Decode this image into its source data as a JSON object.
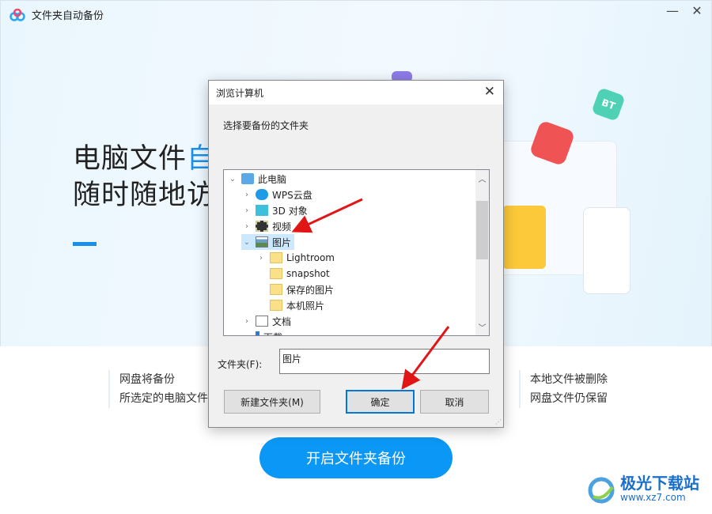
{
  "app": {
    "title": "文件夹自动备份",
    "minimize": "—",
    "close": "✕"
  },
  "hero": {
    "line1_a": "电脑文件",
    "line1_b": "自",
    "line2": "随时随地访"
  },
  "info_left": {
    "line1": "网盘将备份",
    "line2": "所选定的电脑文件"
  },
  "info_right": {
    "line1": "本地文件被删除",
    "line2": "网盘文件仍保留"
  },
  "start_button": "开启文件夹备份",
  "dialog": {
    "title": "浏览计算机",
    "close": "✕",
    "prompt": "选择要备份的文件夹",
    "tree": [
      {
        "label": "此电脑",
        "icon": "computer-icon",
        "expanded": true,
        "level": 0
      },
      {
        "label": "WPS云盘",
        "icon": "cloud-icon",
        "expanded": false,
        "level": 1
      },
      {
        "label": "3D 对象",
        "icon": "cube-icon",
        "expanded": false,
        "level": 1
      },
      {
        "label": "视频",
        "icon": "video-icon",
        "expanded": false,
        "level": 1
      },
      {
        "label": "图片",
        "icon": "pictures-icon",
        "expanded": true,
        "level": 1,
        "selected": true
      },
      {
        "label": "Lightroom",
        "icon": "folder-icon",
        "expanded": false,
        "level": 2
      },
      {
        "label": "snapshot",
        "icon": "folder-icon",
        "level": 2
      },
      {
        "label": "保存的图片",
        "icon": "folder-icon",
        "level": 2
      },
      {
        "label": "本机照片",
        "icon": "folder-icon",
        "level": 2
      },
      {
        "label": "文档",
        "icon": "document-icon",
        "expanded": false,
        "level": 1
      },
      {
        "label": "下载",
        "icon": "download-icon",
        "expanded": false,
        "level": 1
      }
    ],
    "folder_label": "文件夹(F):",
    "folder_value": "图片",
    "new_folder": "新建文件夹(M)",
    "ok": "确定",
    "cancel": "取消"
  },
  "watermark": {
    "name": "极光下载站",
    "url": "www.xz7.com"
  },
  "colors": {
    "accent": "#0a97f5",
    "selection": "#cce8ff",
    "arrow": "#e01515"
  }
}
